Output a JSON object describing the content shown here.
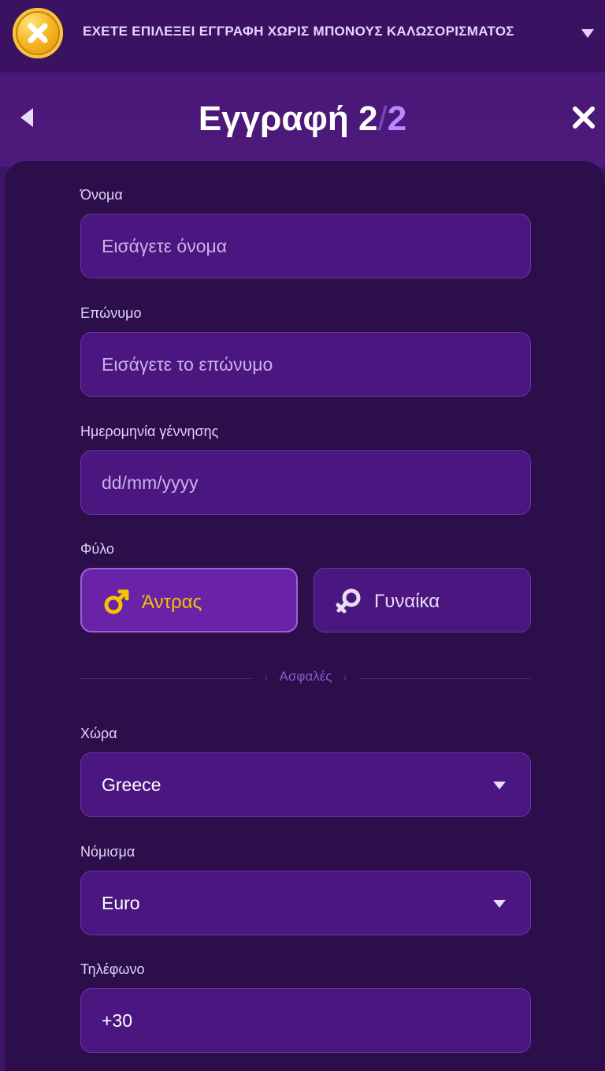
{
  "banner": {
    "text": "ΕΧΕΤΕ ΕΠΙΛΕΞΕΙ ΕΓΓΡΑΦΗ ΧΩΡΙΣ ΜΠΟΝΟΥΣ ΚΑΛΩΣΟΡΙΣΜΑΤΟΣ",
    "icon": "coin-x-icon",
    "toggle_icon": "chevron-down-icon"
  },
  "header": {
    "title_prefix": "Εγγραφή ",
    "step_current": "2",
    "step_separator": "/",
    "step_total": "2",
    "back_icon": "back-arrow-icon",
    "close_icon": "close-icon"
  },
  "form": {
    "first_name": {
      "label": "Όνομα",
      "placeholder": "Εισάγετε όνομα"
    },
    "last_name": {
      "label": "Επώνυμο",
      "placeholder": "Εισάγετε το επώνυμο"
    },
    "birth_date": {
      "label": "Ημερομηνία γέννησης",
      "placeholder": "dd/mm/yyyy"
    },
    "gender": {
      "label": "Φύλο",
      "options": [
        {
          "label": "Άντρας",
          "icon": "male-icon",
          "selected": true
        },
        {
          "label": "Γυναίκα",
          "icon": "female-icon",
          "selected": false
        }
      ]
    },
    "secure_divider": "Ασφαλές",
    "country": {
      "label": "Χώρα",
      "value": "Greece"
    },
    "currency": {
      "label": "Νόμισμα",
      "value": "Euro"
    },
    "phone": {
      "label": "Τηλέφωνο",
      "value": "+30"
    }
  },
  "colors": {
    "background": "#3d1466",
    "panel": "#2b0e4a",
    "field": "#4b1680",
    "selected_option": "#6a23a8",
    "accent_yellow": "#f5c400",
    "accent_purple": "#b889ff"
  }
}
